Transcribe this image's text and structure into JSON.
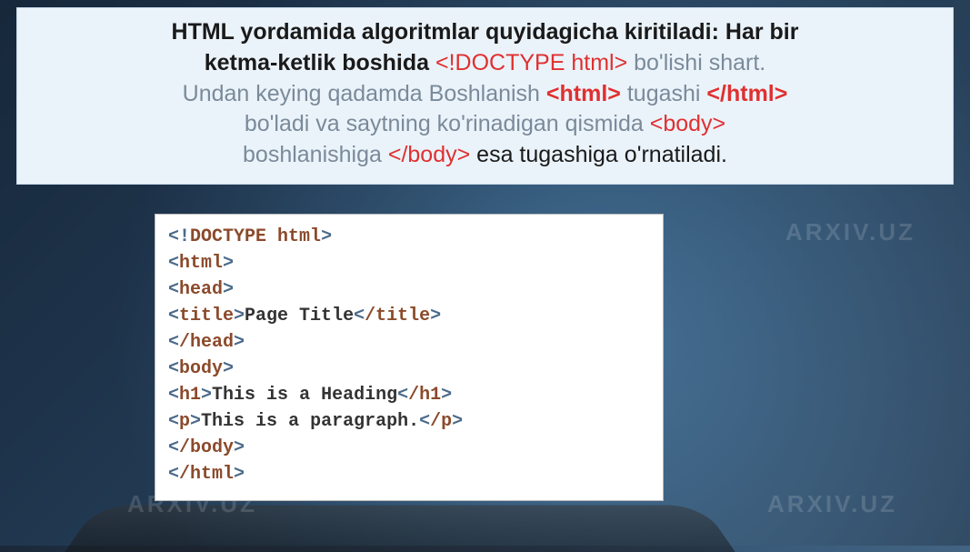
{
  "watermark": "ARXIV.UZ",
  "info": {
    "line1a": "HTML yordamida algoritmlar quyidagicha kiritiladi: Har bir",
    "line2a": "ketma-ketlik boshida ",
    "doctype": "<!DOCTYPE html>",
    "line2b": " bo'lishi shart.",
    "line3a": "Undan keying qadamda Boshlanish ",
    "htmlopen": "<html>",
    "line3b": "  tugashi ",
    "htmlclose": "</html>",
    "line4a": "bo'ladi va saytning ko'rinadigan qismida ",
    "bodyopen": "<body>",
    "line5a": "boshlanishiga ",
    "bodyclose": "</body>",
    "line5b": " esa tugashiga o'rnatiladi."
  },
  "code": {
    "l1_open": "<!",
    "l1_doctype": "DOCTYPE",
    "l1_sp": " ",
    "l1_html": "html",
    "l1_close": ">",
    "l2": "html",
    "l3": "head",
    "l4_open": "title",
    "l4_text": "Page Title",
    "l4_close": "/title",
    "l5": "/head",
    "l6": "body",
    "l7_open": "h1",
    "l7_text": "This is a Heading",
    "l7_close": "/h1",
    "l8_open": "p",
    "l8_text": "This is a paragraph.",
    "l8_close": "/p",
    "l9": "/body",
    "l10": "/html"
  }
}
